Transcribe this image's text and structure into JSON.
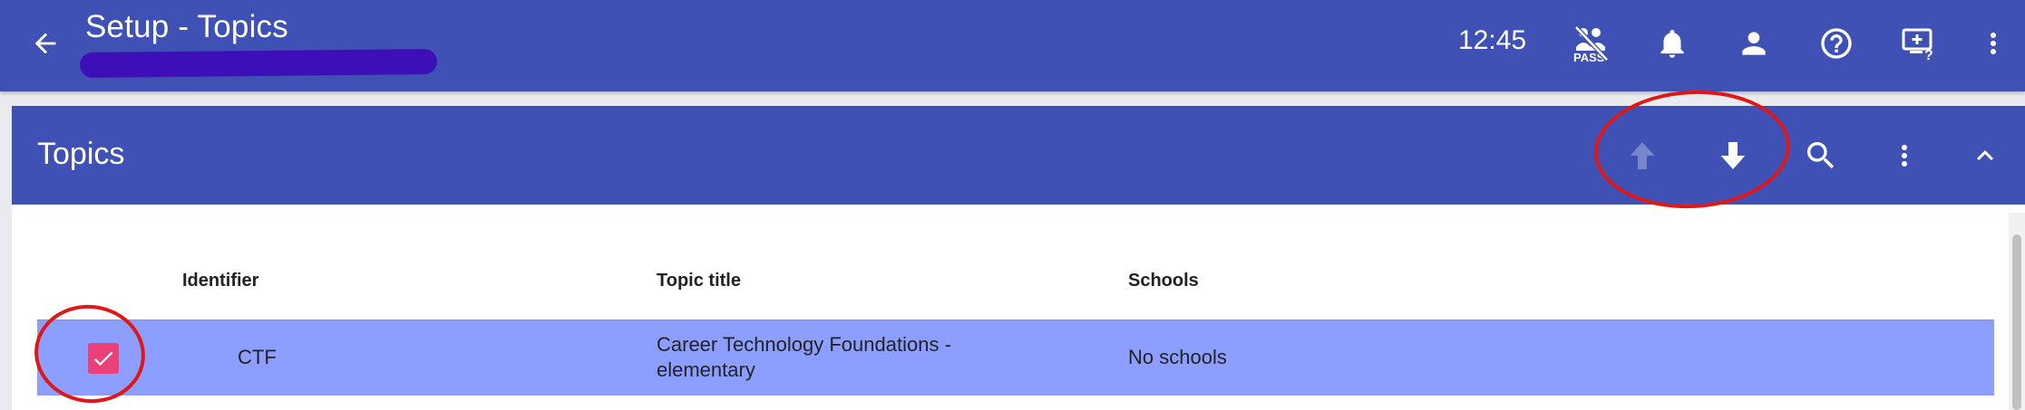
{
  "appbar": {
    "title": "Setup - Topics",
    "time": "12:45",
    "icons": [
      "back-arrow-icon",
      "pass-off-icon",
      "bell-icon",
      "person-icon",
      "help-icon",
      "screen-help-icon",
      "more-vert-icon"
    ]
  },
  "card": {
    "title": "Topics",
    "actions": [
      "move-up-icon",
      "move-down-icon",
      "search-icon",
      "more-vert-icon",
      "collapse-icon"
    ]
  },
  "table": {
    "columns": [
      "Identifier",
      "Topic title",
      "Schools"
    ],
    "rows": [
      {
        "selected": true,
        "identifier": "CTF",
        "title_line1": "Career Technology Foundations -",
        "title_line2": "elementary",
        "schools": "No schools"
      }
    ]
  },
  "colors": {
    "primary": "#3f51b5",
    "selected_row": "#8c9eff",
    "checkbox": "#ec407a",
    "annotation": "#e01717"
  }
}
